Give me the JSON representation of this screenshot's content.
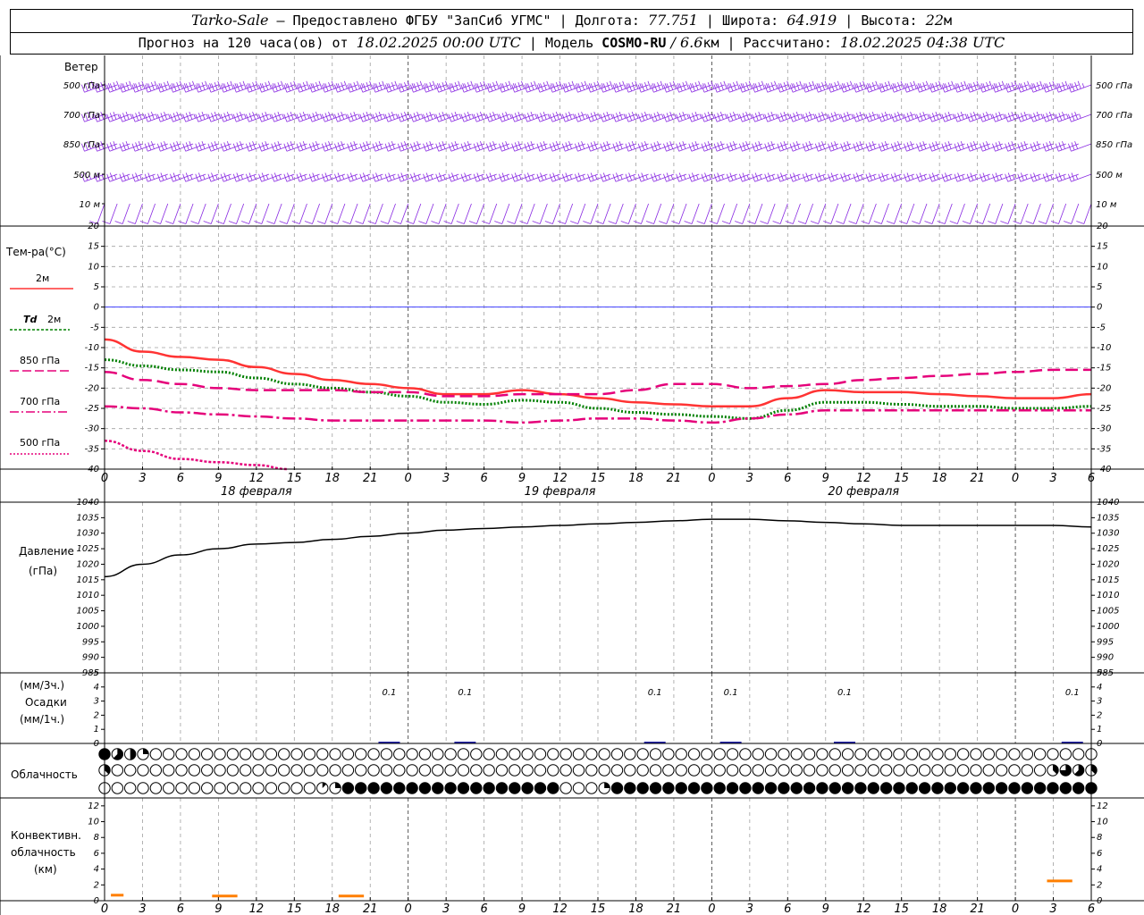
{
  "header": {
    "station": "Tarko-Sale",
    "provided_by": " – Предоставлено ФГБУ \"ЗапСиб УГМС\" | ",
    "lon_label": "Долгота: ",
    "lon_value": "77.751",
    "lat_label": " | Широта: ",
    "lat_value": "64.919",
    "alt_label": " | Высота: ",
    "alt_value": "22",
    "alt_unit": "м",
    "forecast_prefix": "Прогноз на 120 часа(ов) от ",
    "forecast_start": "18.02.2025 00:00 UTC",
    "model_prefix": "  | Модель ",
    "model_name": "COSMO-RU",
    "model_res": " / 6.6",
    "model_res_unit": "км | Рассчитано: ",
    "computed_at": "18.02.2025 04:38 UTC"
  },
  "labels": {
    "wind": "Ветер",
    "wind_levels": [
      "500 гПа",
      "700 гПа",
      "850 гПа",
      "500 м",
      "10 м"
    ],
    "temp": "Тем-ра(°C)",
    "t2m": "2м",
    "td2m_sym": "Td",
    "td2m": "2м",
    "t850": "850 гПа",
    "t700": "700 гПа",
    "t500": "500 гПа",
    "pressure": "Давление",
    "pressure_unit": "(гПа)",
    "precip_3h": "(мм/3ч.)",
    "precip": "Осадки",
    "precip_1h": "(мм/1ч.)",
    "cloud": "Облачность",
    "conv1": "Конвективн.",
    "conv2": "облачность",
    "conv3": "(км)",
    "days": [
      "18 февраля",
      "19 февраля",
      "20 февраля"
    ],
    "hour_ticks": [
      "0",
      "3",
      "6",
      "9",
      "12",
      "15",
      "18",
      "21",
      "0",
      "3",
      "6",
      "9",
      "12",
      "15",
      "18",
      "21",
      "0",
      "3",
      "6",
      "9",
      "12",
      "15",
      "18",
      "21",
      "0",
      "3",
      "6"
    ]
  },
  "colors": {
    "wind": "#8a2be2",
    "t2m": "#ff3333",
    "td2m": "#008000",
    "t850": "#e5007a",
    "t700": "#e5007a",
    "t500": "#e5007a",
    "zero": "#4040ff",
    "pressure": "#000000",
    "precip": "#2222aa",
    "conv": "#ff7f00",
    "grid": "#a0a0a0"
  },
  "chart_data": [
    {
      "type": "line",
      "name": "temperature",
      "x_unit": "hours since 18.02.2025 00:00 UTC",
      "ylim": [
        -40,
        20
      ],
      "y_ticks": [
        20,
        15,
        10,
        5,
        0,
        -5,
        -10,
        -15,
        -20,
        -25,
        -30,
        -35,
        -40
      ],
      "x": [
        0,
        3,
        6,
        9,
        12,
        15,
        18,
        21,
        24,
        27,
        30,
        33,
        36,
        39,
        42,
        45,
        48,
        51,
        54,
        57,
        60,
        63,
        66,
        69,
        72,
        75,
        78
      ],
      "series": [
        {
          "name": "2м",
          "values": [
            -8,
            -11,
            -12.3,
            -13,
            -14.8,
            -16.5,
            -18,
            -19,
            -20,
            -21.5,
            -21.5,
            -20.5,
            -21.5,
            -22.5,
            -23.5,
            -24,
            -24.5,
            -24.5,
            -22.5,
            -20.5,
            -21,
            -21,
            -21.5,
            -22,
            -22.5,
            -22.5,
            -21.5
          ]
        },
        {
          "name": "Td 2м",
          "values": [
            -13,
            -14.5,
            -15.5,
            -16,
            -17.5,
            -19,
            -20,
            -21,
            -22,
            -23.5,
            -24,
            -23,
            -23.5,
            -25,
            -26,
            -26.5,
            -27,
            -27.5,
            -25.5,
            -23.5,
            -23.5,
            -24,
            -24.5,
            -24.5,
            -25,
            -25,
            -24.5
          ]
        },
        {
          "name": "850 гПа",
          "values": [
            -16,
            -18,
            -19,
            -20,
            -20.5,
            -20.5,
            -20.5,
            -21,
            -21,
            -22,
            -22,
            -21.5,
            -21.5,
            -21.5,
            -20.5,
            -19,
            -19,
            -20,
            -19.5,
            -19,
            -18,
            -17.5,
            -17,
            -16.5,
            -16,
            -15.5,
            -15.5
          ]
        },
        {
          "name": "700 гПа",
          "values": [
            -24.5,
            -25,
            -26,
            -26.5,
            -27,
            -27.5,
            -28,
            -28,
            -28,
            -28,
            -28,
            -28.5,
            -28,
            -27.5,
            -27.5,
            -28,
            -28.5,
            -27.5,
            -26.5,
            -25.5,
            -25.5,
            -25.5,
            -25.5,
            -25.5,
            -25.5,
            -25.5,
            -25.5
          ]
        },
        {
          "name": "500 гПа",
          "x": [
            0,
            3,
            6,
            9,
            12,
            14.5
          ],
          "values": [
            -33,
            -35.5,
            -37.5,
            -38.3,
            -39,
            -40
          ]
        }
      ]
    },
    {
      "type": "line",
      "name": "pressure",
      "ylim": [
        985,
        1040
      ],
      "y_ticks": [
        1040,
        1035,
        1030,
        1025,
        1020,
        1015,
        1010,
        1005,
        1000,
        995,
        990,
        985
      ],
      "x": [
        0,
        3,
        6,
        9,
        12,
        15,
        18,
        21,
        24,
        27,
        30,
        33,
        36,
        39,
        42,
        45,
        48,
        51,
        54,
        57,
        60,
        63,
        66,
        69,
        72,
        75,
        78
      ],
      "values": [
        1016,
        1020,
        1023,
        1025,
        1026.5,
        1027,
        1028,
        1029,
        1030,
        1031,
        1031.5,
        1032,
        1032.5,
        1033,
        1033.5,
        1034,
        1034.5,
        1034.5,
        1034,
        1033.5,
        1033,
        1032.5,
        1032.5,
        1032.5,
        1032.5,
        1032.5,
        1032
      ]
    },
    {
      "type": "bar",
      "name": "precipitation",
      "ylim": [
        0,
        5
      ],
      "y_ticks": [
        5,
        4,
        3,
        2,
        1,
        0
      ],
      "x": [
        22.5,
        28.5,
        43.5,
        49.5,
        58.5,
        76.5
      ],
      "values": [
        0.1,
        0.1,
        0.1,
        0.1,
        0.1,
        0.1
      ],
      "labels": [
        "0.1",
        "0.1",
        "0.1",
        "0.1",
        "0.1",
        "0.1"
      ]
    },
    {
      "type": "bar",
      "name": "convective_cloud",
      "ylim": [
        0,
        13
      ],
      "y_ticks": [
        12,
        10,
        8,
        6,
        4,
        2,
        0
      ],
      "segments": [
        {
          "x0": 0.5,
          "x1": 1.5,
          "value": 0.7
        },
        {
          "x0": 8.5,
          "x1": 10.5,
          "value": 0.6
        },
        {
          "x0": 18.5,
          "x1": 20.5,
          "value": 0.6
        },
        {
          "x0": 74.5,
          "x1": 76.5,
          "value": 2.5
        }
      ]
    },
    {
      "type": "table",
      "name": "cloud_cover_octas",
      "x_step_hours": 1,
      "rows": {
        "high": [
          8,
          5,
          4,
          2,
          0,
          0,
          0,
          0,
          0,
          0,
          0,
          0,
          0,
          0,
          0,
          0,
          0,
          0,
          0,
          0,
          0,
          0,
          0,
          0,
          0,
          0,
          0,
          0,
          0,
          0,
          0,
          0,
          0,
          0,
          0,
          0,
          0,
          0,
          0,
          0,
          0,
          0,
          0,
          0,
          0,
          0,
          0,
          0,
          0,
          0,
          0,
          0,
          0,
          0,
          0,
          0,
          0,
          0,
          0,
          0,
          0,
          0,
          0,
          0,
          0,
          0,
          0,
          0,
          0,
          0,
          0,
          0,
          0,
          0,
          0,
          0,
          0,
          0
        ],
        "middle": [
          3,
          0,
          0,
          0,
          0,
          0,
          0,
          0,
          0,
          0,
          0,
          0,
          0,
          0,
          0,
          0,
          0,
          0,
          0,
          0,
          0,
          0,
          0,
          0,
          0,
          0,
          0,
          0,
          0,
          0,
          0,
          0,
          0,
          0,
          0,
          0,
          0,
          0,
          0,
          0,
          0,
          0,
          0,
          0,
          0,
          0,
          0,
          0,
          0,
          0,
          0,
          0,
          0,
          0,
          0,
          0,
          0,
          0,
          0,
          0,
          0,
          0,
          0,
          0,
          0,
          0,
          0,
          0,
          0,
          0,
          0,
          0,
          0,
          0,
          3,
          6,
          5,
          3
        ],
        "low": [
          0,
          0,
          0,
          0,
          0,
          0,
          0,
          0,
          0,
          0,
          0,
          0,
          0,
          0,
          0,
          0,
          0,
          1,
          2,
          8,
          8,
          8,
          8,
          8,
          8,
          8,
          8,
          8,
          8,
          8,
          8,
          8,
          8,
          8,
          8,
          8,
          0,
          0,
          0,
          2,
          8,
          8,
          8,
          8,
          8,
          8,
          8,
          8,
          8,
          8,
          8,
          8,
          8,
          8,
          8,
          8,
          8,
          8,
          8,
          8,
          8,
          8,
          8,
          8,
          8,
          8,
          8,
          8,
          8,
          8,
          8,
          8,
          8,
          8,
          8,
          8,
          8,
          8
        ]
      }
    },
    {
      "type": "table",
      "name": "wind_barbs",
      "levels": [
        "500 гПа",
        "700 гПа",
        "850 гПа",
        "500 м",
        "10 м"
      ],
      "direction_deg": [
        250,
        250,
        250,
        250,
        200
      ],
      "speed_kt": [
        45,
        35,
        30,
        25,
        10
      ]
    }
  ]
}
